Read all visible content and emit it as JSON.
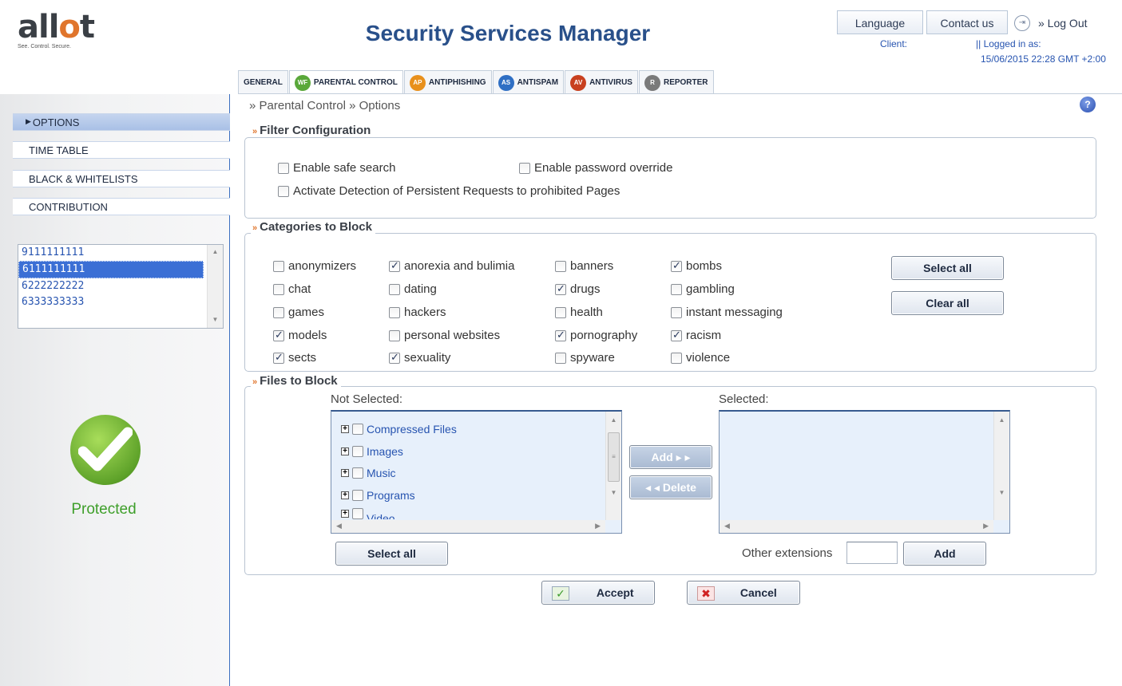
{
  "header": {
    "logo_text": "allot",
    "logo_tagline": "See. Control. Secure.",
    "app_title": "Security Services Manager",
    "language_label": "Language",
    "contact_label": "Contact us",
    "logout_label": "» Log Out",
    "client_label": "Client:",
    "logged_in_label": "||   Logged in as:",
    "datetime": "15/06/2015 22:28 GMT +2:00"
  },
  "tabs": [
    {
      "label": "GENERAL",
      "icon": "",
      "active": false
    },
    {
      "label": "PARENTAL CONTROL",
      "icon": "WF",
      "color": "#5aa83a",
      "active": true
    },
    {
      "label": "ANTIPHISHING",
      "icon": "AP",
      "color": "#e8901c",
      "active": false
    },
    {
      "label": "ANTISPAM",
      "icon": "AS",
      "color": "#2f6fc4",
      "active": false
    },
    {
      "label": "ANTIVIRUS",
      "icon": "AV",
      "color": "#c8401f",
      "active": false
    },
    {
      "label": "REPORTER",
      "icon": "R",
      "color": "#7a7a7a",
      "active": false
    }
  ],
  "sidebar": {
    "items": [
      "OPTIONS",
      "TIME TABLE",
      "BLACK & WHITELISTS",
      "CONTRIBUTION"
    ],
    "clients": [
      "9111111111",
      "6111111111",
      "6222222222",
      "6333333333"
    ],
    "selected_client": 1,
    "status_label": "Protected"
  },
  "breadcrumb": "»  Parental Control »  Options",
  "filter_config": {
    "title": "Filter Configuration",
    "options": [
      {
        "label": "Enable safe search",
        "checked": false
      },
      {
        "label": "Enable password override",
        "checked": false
      },
      {
        "label": "Activate Detection of Persistent Requests to prohibited Pages",
        "checked": false
      }
    ]
  },
  "categories": {
    "title": "Categories to Block",
    "items": [
      {
        "label": "anonymizers",
        "checked": false
      },
      {
        "label": "anorexia and bulimia",
        "checked": true
      },
      {
        "label": "banners",
        "checked": false
      },
      {
        "label": "bombs",
        "checked": true
      },
      {
        "label": "chat",
        "checked": false
      },
      {
        "label": "dating",
        "checked": false
      },
      {
        "label": "drugs",
        "checked": true
      },
      {
        "label": "gambling",
        "checked": false
      },
      {
        "label": "games",
        "checked": false
      },
      {
        "label": "hackers",
        "checked": false
      },
      {
        "label": "health",
        "checked": false
      },
      {
        "label": "instant messaging",
        "checked": false
      },
      {
        "label": "models",
        "checked": true
      },
      {
        "label": "personal websites",
        "checked": false
      },
      {
        "label": "pornography",
        "checked": true
      },
      {
        "label": "racism",
        "checked": true
      },
      {
        "label": "sects",
        "checked": true
      },
      {
        "label": "sexuality",
        "checked": true
      },
      {
        "label": "spyware",
        "checked": false
      },
      {
        "label": "violence",
        "checked": false
      }
    ],
    "select_all_label": "Select all",
    "clear_all_label": "Clear all"
  },
  "files": {
    "title": "Files to Block",
    "not_selected_label": "Not Selected:",
    "selected_label": "Selected:",
    "tree": [
      "Compressed Files",
      "Images",
      "Music",
      "Programs",
      "Video"
    ],
    "add_label": "Add ▸ ▸",
    "delete_label": "◂ ◂ Delete",
    "select_all_label": "Select all",
    "other_extensions_label": "Other extensions",
    "other_extensions_value": "",
    "add_ext_label": "Add"
  },
  "actions": {
    "accept_label": "Accept",
    "cancel_label": "Cancel"
  }
}
